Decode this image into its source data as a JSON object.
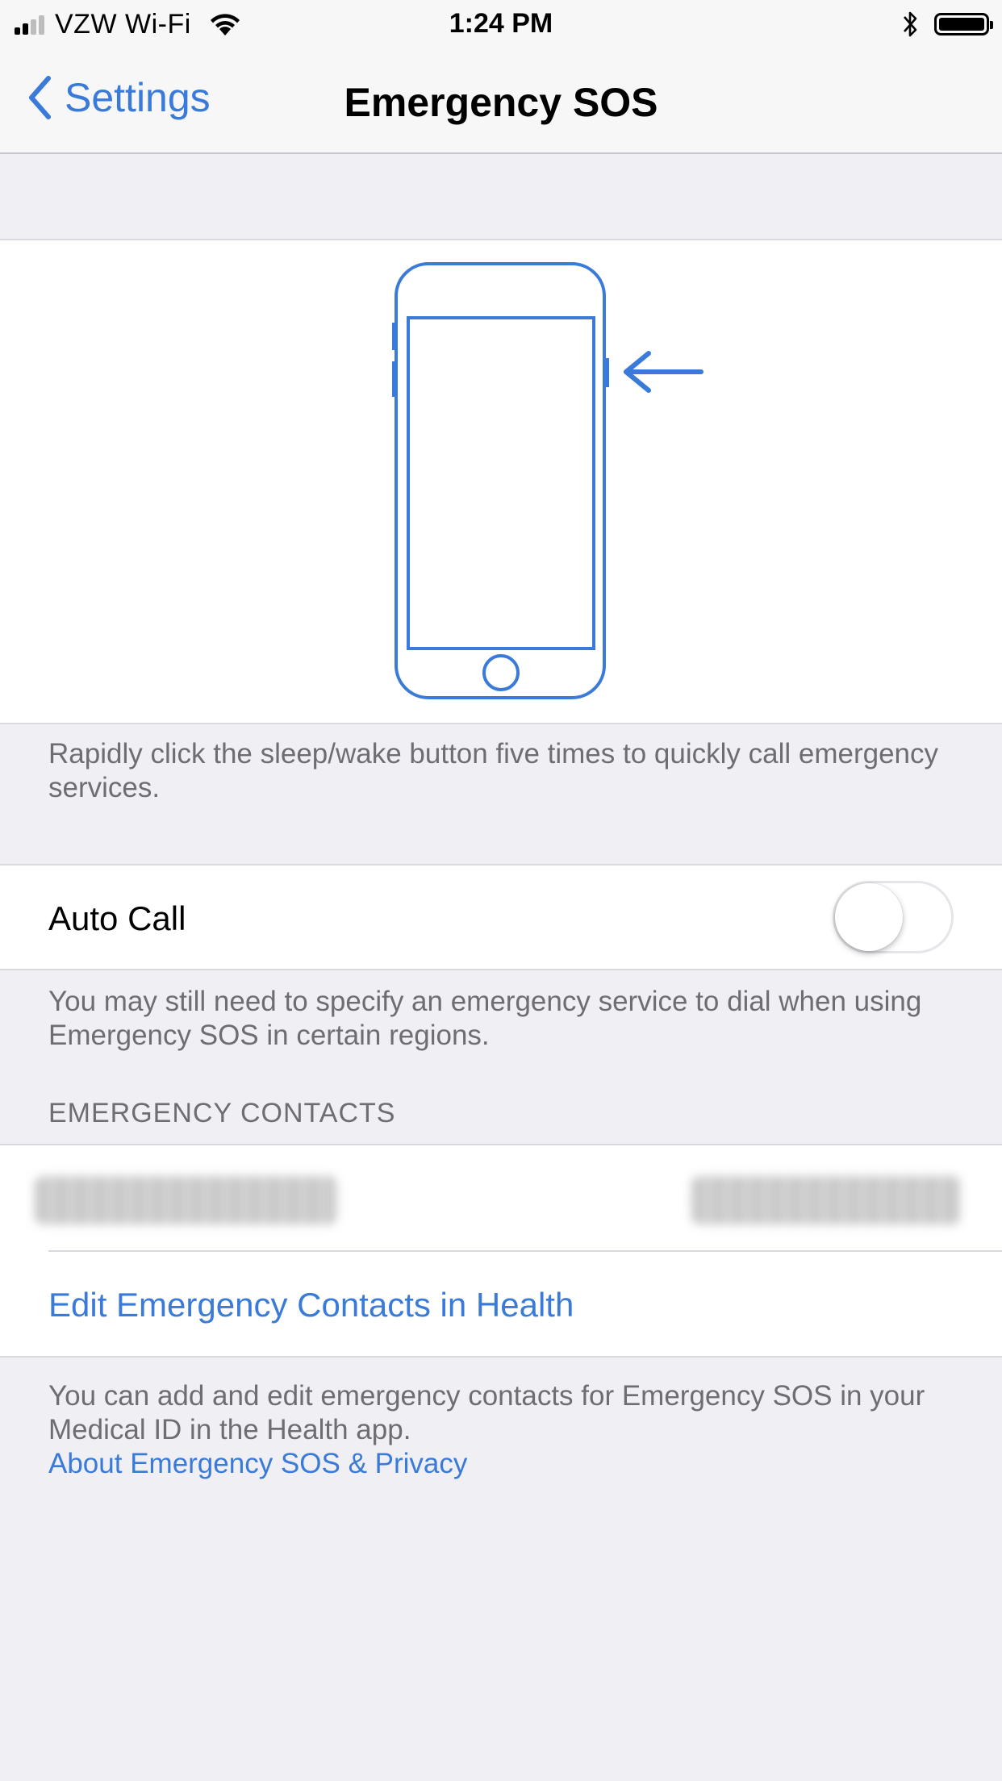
{
  "status_bar": {
    "carrier": "VZW Wi-Fi",
    "time": "1:24 PM",
    "icons": [
      "signal-icon",
      "wifi-icon",
      "bluetooth-icon",
      "battery-icon"
    ]
  },
  "nav": {
    "back_label": "Settings",
    "title": "Emergency SOS"
  },
  "illustration": {
    "icon": "iphone-side-button-illustration",
    "accent": "#3a7ad8"
  },
  "sos_description": "Rapidly click the sleep/wake button five times to quickly call emergency services.",
  "auto_call": {
    "label": "Auto Call",
    "enabled": false
  },
  "auto_call_note": "You may still need to specify an emergency service to dial when using Emergency SOS in certain regions.",
  "contacts_section": {
    "header": "EMERGENCY CONTACTS",
    "edit_link": "Edit Emergency Contacts in Health"
  },
  "footer": {
    "text": "You can add and edit emergency contacts for Emergency SOS in your Medical ID in the Health app.",
    "link": "About Emergency SOS & Privacy"
  },
  "colors": {
    "accent": "#3a7ad8",
    "grouped_background": "#efeff4",
    "secondary_text": "#6d6d72"
  }
}
